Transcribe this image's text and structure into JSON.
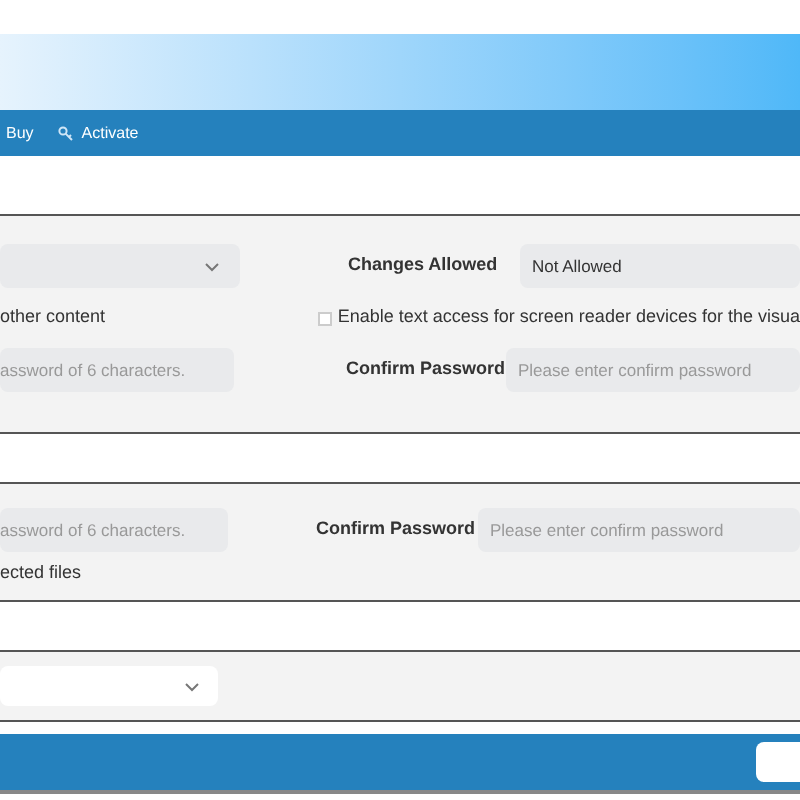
{
  "menu": [
    {
      "label": "Buy",
      "icon": false
    },
    {
      "label": "Activate",
      "icon": true
    }
  ],
  "permissions_panel": {
    "changes_label": "Changes Allowed",
    "changes_value": "Not Allowed",
    "content_option": "other content",
    "screen_reader": {
      "label": "Enable text access for screen reader devices for the visua",
      "checked": false
    },
    "password_placeholder": "assword of 6 characters.",
    "confirm_label": "Confirm Password",
    "confirm_placeholder": "Please enter confirm password"
  },
  "open_panel": {
    "password_placeholder": "assword of 6 characters.",
    "confirm_label": "Confirm Password",
    "confirm_placeholder": "Please enter confirm password",
    "files_option": "ected files"
  }
}
